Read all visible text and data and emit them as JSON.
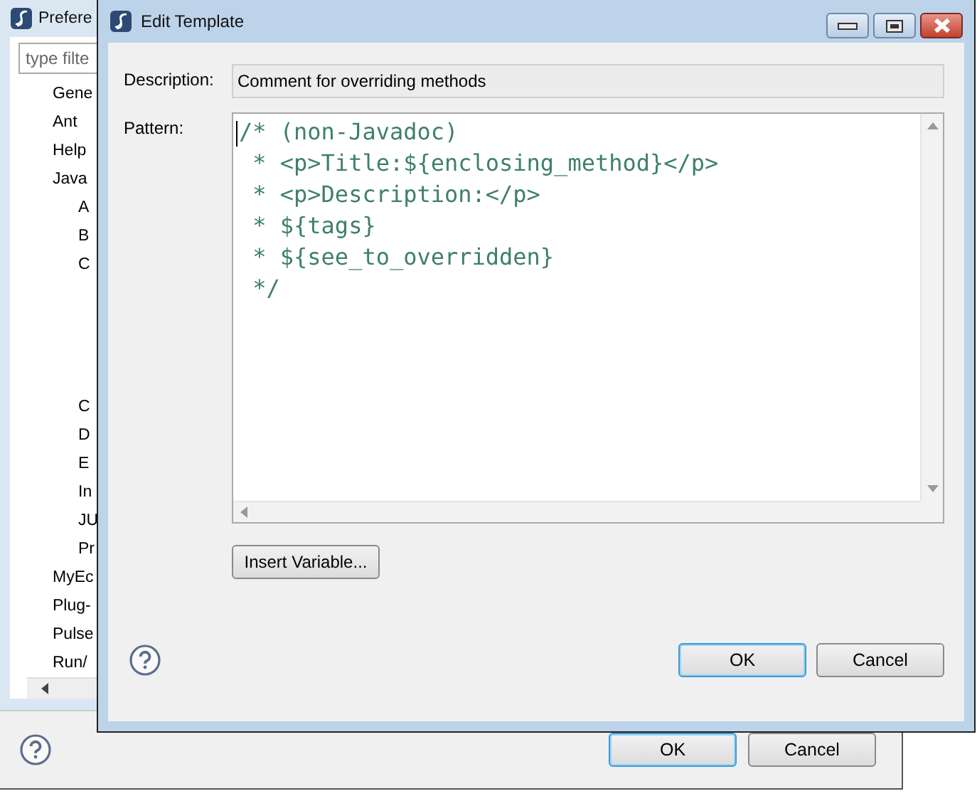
{
  "background_window": {
    "title": "Prefere",
    "filter": {
      "placeholder": "type filte"
    },
    "tree": [
      {
        "label": "Gene"
      },
      {
        "label": "Ant"
      },
      {
        "label": "Help"
      },
      {
        "label": "Java",
        "children": [
          {
            "label": "A"
          },
          {
            "label": "B"
          },
          {
            "label": "C"
          },
          {
            "label": "C"
          },
          {
            "label": "D"
          },
          {
            "label": "E"
          },
          {
            "label": "In"
          },
          {
            "label": "JU"
          },
          {
            "label": "Pr"
          }
        ]
      },
      {
        "label": "MyEc"
      },
      {
        "label": "Plug-"
      },
      {
        "label": "Pulse"
      },
      {
        "label": "Run/"
      }
    ],
    "buttons": [
      {
        "label": "OK",
        "default": true
      },
      {
        "label": "Cancel",
        "default": false
      }
    ]
  },
  "dialog": {
    "title": "Edit Template",
    "description": {
      "label": "Description:",
      "value": "Comment for overriding methods"
    },
    "pattern": {
      "label": "Pattern:",
      "lines": [
        "/* (non-Javadoc)",
        " * <p>Title:${enclosing_method}</p>",
        " * <p>Description:</p>",
        " * ${tags}",
        " * ${see_to_overridden}",
        " */"
      ]
    },
    "insert_button": "Insert Variable...",
    "buttons": [
      {
        "label": "OK",
        "default": true
      },
      {
        "label": "Cancel",
        "default": false
      }
    ]
  }
}
